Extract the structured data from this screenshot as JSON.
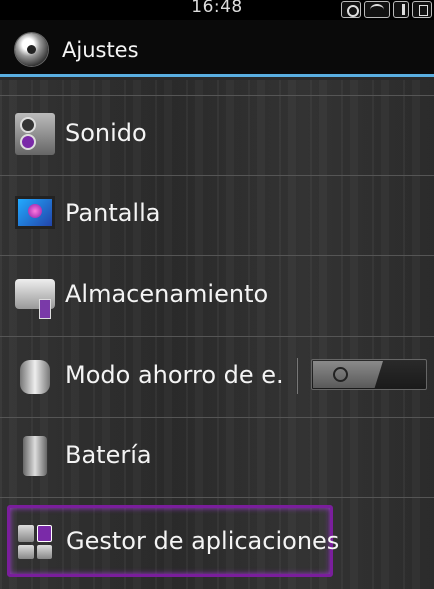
{
  "status_bar": {
    "time": "16:48",
    "icons": [
      "alarm-icon",
      "wifi-icon",
      "signal-icon",
      "battery-icon"
    ]
  },
  "action_bar": {
    "title": "Ajustes",
    "accent_color": "#5aaee0"
  },
  "settings_items": [
    {
      "label": "Sonido",
      "icon": "speaker-icon"
    },
    {
      "label": "Pantalla",
      "icon": "monitor-icon"
    },
    {
      "label": "Almacenamiento",
      "icon": "storage-icon"
    },
    {
      "label": "Modo ahorro de e.",
      "icon": "plug-icon",
      "toggle_state": "off"
    },
    {
      "label": "Batería",
      "icon": "battery-item-icon"
    },
    {
      "label": "Gestor de aplicaciones",
      "icon": "apps-icon",
      "highlight_color": "#7a1e9c"
    }
  ]
}
